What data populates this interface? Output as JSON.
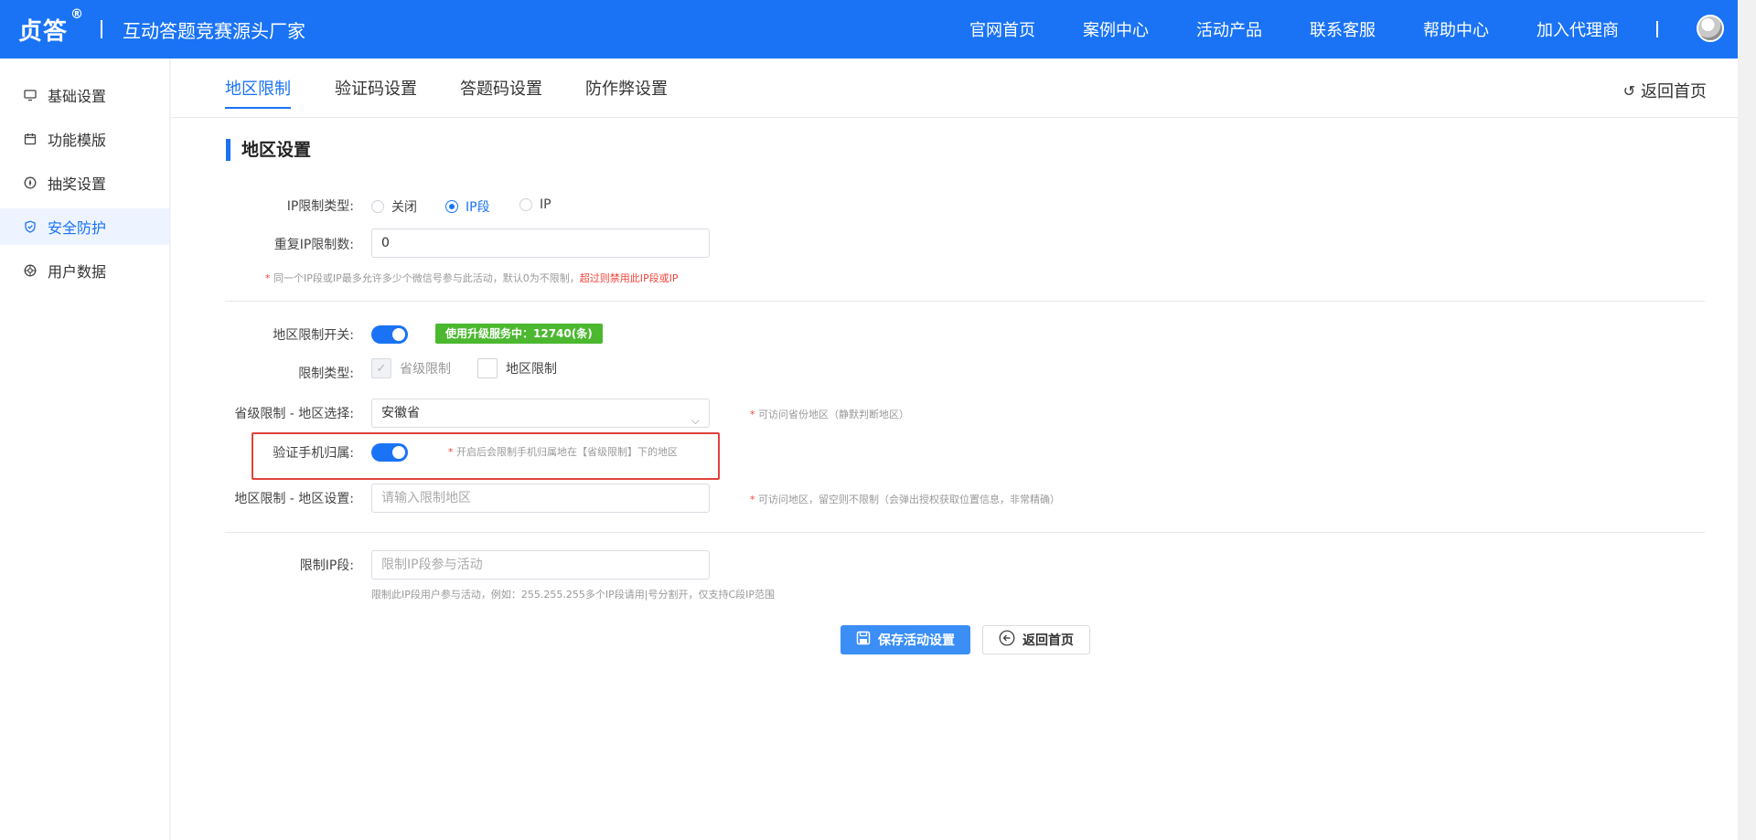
{
  "header": {
    "logo": "贞答",
    "registered_mark": "®",
    "slogan": "互动答题竞赛源头厂家",
    "nav": [
      "官网首页",
      "案例中心",
      "活动产品",
      "联系客服",
      "帮助中心",
      "加入代理商"
    ],
    "brand_color": "#1a73f5"
  },
  "sidebar": {
    "items": [
      {
        "label": "基础设置",
        "icon": "monitor-icon"
      },
      {
        "label": "功能模版",
        "icon": "calendar-icon"
      },
      {
        "label": "抽奖设置",
        "icon": "compass-icon"
      },
      {
        "label": "安全防护",
        "icon": "shield-icon",
        "active": true
      },
      {
        "label": "用户数据",
        "icon": "aperture-icon"
      }
    ]
  },
  "tabs": [
    "地区限制",
    "验证码设置",
    "答题码设置",
    "防作弊设置"
  ],
  "active_tab": "地区限制",
  "back_home_label": "返回首页",
  "section_title": "地区设置",
  "ip_limit": {
    "label": "IP限制类型:",
    "options": [
      "关闭",
      "IP段",
      "IP"
    ],
    "selected": "IP段"
  },
  "repeat_ip": {
    "label": "重复IP限制数:",
    "value": "0",
    "hint_star": "*",
    "hint": "同一个IP段或IP最多允许多少个微信号参与此活动，默认0为不限制，",
    "hint_warn": "超过则禁用此IP段或IP"
  },
  "region_switch": {
    "label": "地区限制开关:",
    "on": true,
    "badge": "使用升级服务中：12740(条)"
  },
  "limit_type": {
    "label": "限制类型:",
    "options": [
      {
        "label": "省级限制",
        "checked": true
      },
      {
        "label": "地区限制",
        "checked": false
      }
    ]
  },
  "province_select": {
    "label": "省级限制 - 地区选择:",
    "value": "安徽省",
    "hint_star": "*",
    "hint": "可访问省份地区（静默判断地区）"
  },
  "verify_phone": {
    "label": "验证手机归属:",
    "on": true,
    "hint_star": "*",
    "hint": "开启后会限制手机归属地在【省级限制】下的地区"
  },
  "region_setting": {
    "label": "地区限制 - 地区设置:",
    "placeholder": "请输入限制地区",
    "hint_star": "*",
    "hint": "可访问地区，留空则不限制（会弹出授权获取位置信息，非常精确）"
  },
  "ip_segment": {
    "label": "限制IP段:",
    "placeholder": "限制IP段参与活动",
    "hint": "限制此IP段用户参与活动，例如：255.255.255多个IP段请用|号分割开，仅支持C段IP范围"
  },
  "buttons": {
    "save": "保存活动设置",
    "back": "返回首页"
  }
}
